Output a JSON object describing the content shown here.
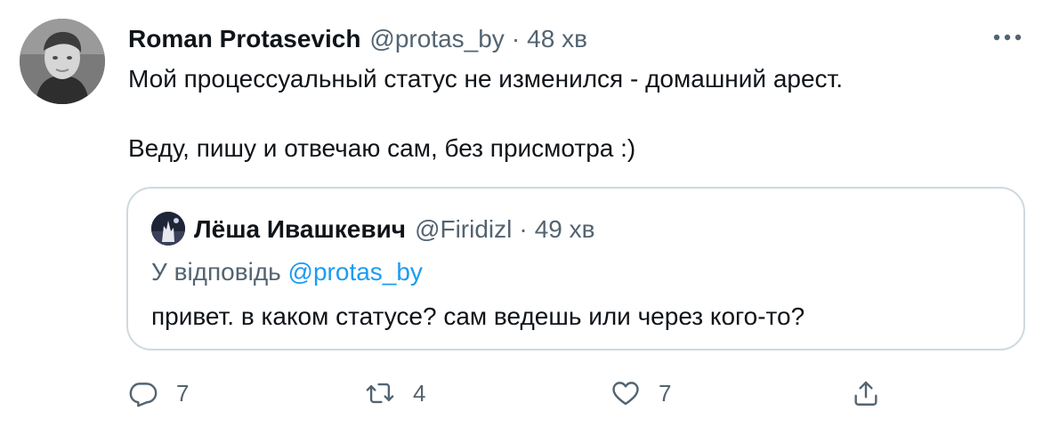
{
  "tweet": {
    "author_name": "Roman Protasevich",
    "handle": "@protas_by",
    "separator": "·",
    "time": "48 хв",
    "text_line1": "Мой процессуальный статус не изменился - домашний арест.",
    "text_line2": "Веду, пишу и отвечаю сам, без присмотра :)"
  },
  "quoted": {
    "author_name": "Лёша Ивашкевич",
    "handle": "@Firidizl",
    "separator": "·",
    "time": "49 хв",
    "reply_prefix": "У відповідь",
    "reply_handle": "@protas_by",
    "text": "привет. в каком статусе? сам ведешь или через кого-то?"
  },
  "actions": {
    "reply_count": "7",
    "retweet_count": "4",
    "like_count": "7",
    "icons": [
      "reply-icon",
      "retweet-icon",
      "like-icon",
      "share-icon"
    ]
  },
  "colors": {
    "text": "#0f1419",
    "secondary": "#536471",
    "link": "#1d9bf0",
    "border": "#cfd9de"
  }
}
